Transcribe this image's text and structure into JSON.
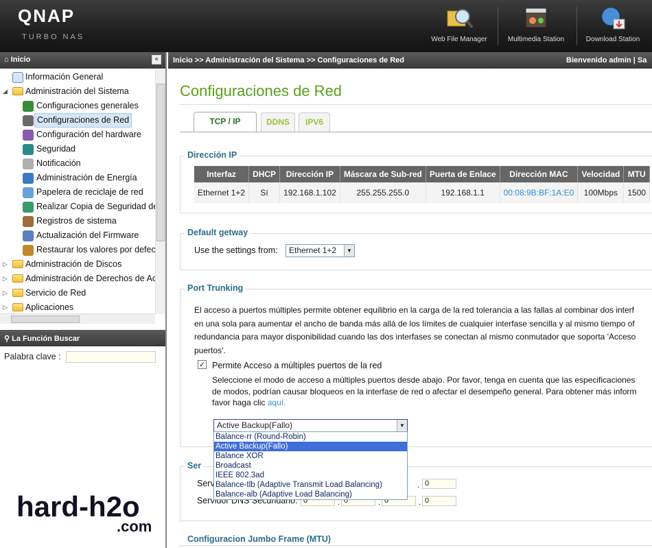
{
  "header": {
    "logo": "QNAP",
    "logo_sub": "TURBO NAS",
    "apps": [
      {
        "label": "Web File Manager",
        "icon": "web-file-manager-icon"
      },
      {
        "label": "Multimedia Station",
        "icon": "multimedia-station-icon"
      },
      {
        "label": "Download Station",
        "icon": "download-station-icon"
      }
    ]
  },
  "left": {
    "title": "Inicio",
    "collapse_glyph": "«",
    "tree": [
      {
        "label": "Información General",
        "level": 0,
        "icon": "info-icon"
      },
      {
        "label": "Administración del Sistema",
        "level": 0,
        "expanded": true,
        "icon": "folder-icon"
      },
      {
        "label": "Configuraciones generales",
        "level": 1,
        "icon": "general-settings-icon"
      },
      {
        "label": "Configuraciones de Red",
        "level": 1,
        "selected": true,
        "icon": "network-icon"
      },
      {
        "label": "Configuración del hardware",
        "level": 1,
        "icon": "hardware-icon"
      },
      {
        "label": "Seguridad",
        "level": 1,
        "icon": "security-icon"
      },
      {
        "label": "Notificación",
        "level": 1,
        "icon": "notification-icon"
      },
      {
        "label": "Administración de Energía",
        "level": 1,
        "icon": "power-icon"
      },
      {
        "label": "Papelera de reciclaje de red",
        "level": 1,
        "icon": "recycle-bin-icon"
      },
      {
        "label": "Realizar Copia de Seguridad de",
        "level": 1,
        "icon": "backup-icon"
      },
      {
        "label": "Registros de sistema",
        "level": 1,
        "icon": "logs-icon"
      },
      {
        "label": "Actualización del Firmware",
        "level": 1,
        "icon": "firmware-icon"
      },
      {
        "label": "Restaurar los valores por defec",
        "level": 1,
        "icon": "restore-icon"
      },
      {
        "label": "Administración de Discos",
        "level": 0,
        "icon": "folder-icon"
      },
      {
        "label": "Administración de Derechos de Ac",
        "level": 0,
        "icon": "folder-icon"
      },
      {
        "label": "Servicio de Red",
        "level": 0,
        "icon": "folder-icon"
      },
      {
        "label": "Aplicaciones",
        "level": 0,
        "icon": "folder-icon"
      }
    ],
    "search_title": "La Función Buscar",
    "search_label": "Palabra clave :",
    "search_value": ""
  },
  "topbar": {
    "breadcrumb": "Inicio >> Administración del Sistema >> Configuraciones de Red",
    "welcome": "Bienvenido admin | Sa"
  },
  "main": {
    "title": "Configuraciones de Red",
    "tabs": [
      {
        "label": "TCP / IP",
        "active": true
      },
      {
        "label": "DDNS"
      },
      {
        "label": "IPV6"
      }
    ],
    "ip_section": {
      "legend": "Dirección IP",
      "columns": [
        "Interfaz",
        "DHCP",
        "Dirección IP",
        "Máscara de Sub-red",
        "Puerta de Enlace",
        "Dirección MAC",
        "Velocidad",
        "MTU"
      ],
      "rows": [
        [
          "Ethernet 1+2",
          "Sí",
          "192.168.1.102",
          "255.255.255.0",
          "192.168.1.1",
          "00:08:9B:BF:1A:E0",
          "100Mbps",
          "1500"
        ]
      ]
    },
    "gateway_section": {
      "legend": "Default getway",
      "label": "Use the settings from:",
      "value": "Ethernet 1+2"
    },
    "trunk_section": {
      "legend": "Port Trunking",
      "line1": "El acceso a puertos múltiples permite obtener equilibrio en la carga de la red tolerancia a las fallas al combinar dos interf",
      "line2": "en una sola para aumentar el ancho de banda más allá de los límites de cualquier interfase sencilla y al mismo tiempo of",
      "line3": "redundancia para mayor disponibilidad cuando las dos interfases se conectan al mismo conmutador que soporta 'Acceso",
      "line4": "puertos'.",
      "checkbox_label": "Permite Acceso a múltiples puertos de la red",
      "checkbox_checked": true,
      "help1": "Seleccione el modo de acceso a múltiples puertos desde abajo. Por favor, tenga en cuenta que las especificaciones",
      "help2": "de modos, podrían causar bloqueos en la interfase de red o afectar el desempeño general. Para obtener más inform",
      "help3": "favor haga clic",
      "help_link": "aquí.",
      "mode_selected": "Active Backup(Fallo)",
      "mode_options": [
        "Balance-rr (Round-Robin)",
        "Active Backup(Fallo)",
        "Balance XOR",
        "Broadcast",
        "IEEE 802.3ad",
        "Balance-tlb (Adaptive Transmit Load Balancing)",
        "Balance-alb (Adaptive Load Balancing)"
      ],
      "highlighted_option": 1
    },
    "dns_section": {
      "legend_fragment": "Ser",
      "primary_label_fragment": "Servi",
      "secondary_label": "Servidor DNS Secundario:",
      "secondary_ip": [
        "0",
        "0",
        "0",
        "0"
      ],
      "primary_last": "0"
    },
    "jumbo_section": {
      "legend": "Configuracion Jumbo Frame (MTU)"
    }
  },
  "watermark": {
    "main": "hard-h2o",
    "sub": ".com"
  },
  "colors": {
    "title_green": "#5ba01a",
    "legend_blue": "#2a6d8c",
    "link_blue": "#2f8fd6"
  }
}
